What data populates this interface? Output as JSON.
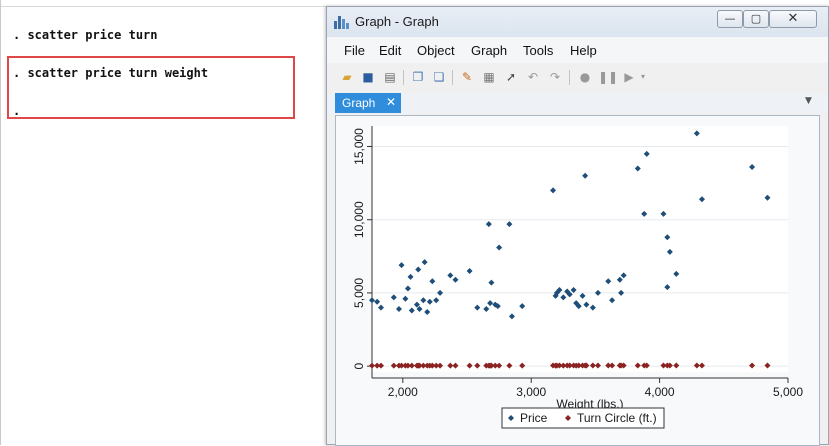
{
  "results": {
    "commands": [
      ". scatter price turn",
      ". scatter price turn weight",
      "."
    ]
  },
  "window": {
    "title": "Graph - Graph",
    "buttons": {
      "minimize": "—",
      "maximize": "▢",
      "close": "✕"
    }
  },
  "menu": [
    "File",
    "Edit",
    "Object",
    "Graph",
    "Tools",
    "Help"
  ],
  "toolbar": {
    "icons": [
      "open-icon",
      "save-icon",
      "print-icon",
      "copy-icon",
      "copy-graph-icon",
      "graph-editor-icon",
      "object-browser-icon",
      "pointer-icon",
      "undo-icon",
      "redo-icon",
      "record-icon",
      "pause-icon",
      "play-icon"
    ]
  },
  "tab": {
    "label": "Graph",
    "close": "✕"
  },
  "colors": {
    "price": "#1f4e79",
    "turn": "#8b2323",
    "tab": "#2f8ddb",
    "highlight": "#e04848"
  },
  "chart_data": {
    "type": "scatter",
    "xlabel": "Weight (lbs.)",
    "ylabel": "",
    "xlim": [
      1760,
      5000
    ],
    "ylim": [
      -400,
      16400
    ],
    "x_ticks": [
      2000,
      3000,
      4000,
      5000
    ],
    "x_tick_labels": [
      "2,000",
      "3,000",
      "4,000",
      "5,000"
    ],
    "y_ticks": [
      0,
      5000,
      10000,
      15000
    ],
    "y_tick_labels": [
      "0",
      "5,000",
      "10,000",
      "15,000"
    ],
    "grid": true,
    "legend": {
      "position": "bottom",
      "entries": [
        "Price",
        "Turn Circle (ft.)"
      ]
    },
    "series": [
      {
        "name": "Price",
        "marker": "diamond",
        "points": [
          [
            1760,
            4500
          ],
          [
            1800,
            4400
          ],
          [
            1830,
            4000
          ],
          [
            1930,
            4700
          ],
          [
            1970,
            3900
          ],
          [
            1990,
            6900
          ],
          [
            2020,
            4600
          ],
          [
            2040,
            5300
          ],
          [
            2060,
            6100
          ],
          [
            2070,
            3800
          ],
          [
            2110,
            4200
          ],
          [
            2120,
            6600
          ],
          [
            2130,
            3900
          ],
          [
            2160,
            4500
          ],
          [
            2170,
            7100
          ],
          [
            2190,
            3700
          ],
          [
            2210,
            4400
          ],
          [
            2230,
            5800
          ],
          [
            2260,
            4500
          ],
          [
            2290,
            5000
          ],
          [
            2370,
            6200
          ],
          [
            2410,
            5900
          ],
          [
            2520,
            6500
          ],
          [
            2580,
            4000
          ],
          [
            2650,
            3900
          ],
          [
            2670,
            9700
          ],
          [
            2680,
            4300
          ],
          [
            2690,
            5700
          ],
          [
            2720,
            4200
          ],
          [
            2740,
            4100
          ],
          [
            2750,
            8100
          ],
          [
            2830,
            9700
          ],
          [
            2850,
            3400
          ],
          [
            2930,
            4100
          ],
          [
            3170,
            12000
          ],
          [
            3190,
            4800
          ],
          [
            3200,
            5000
          ],
          [
            3220,
            5200
          ],
          [
            3250,
            4700
          ],
          [
            3280,
            5100
          ],
          [
            3300,
            4900
          ],
          [
            3330,
            5200
          ],
          [
            3350,
            4300
          ],
          [
            3370,
            4100
          ],
          [
            3400,
            4800
          ],
          [
            3420,
            13000
          ],
          [
            3430,
            4200
          ],
          [
            3480,
            4000
          ],
          [
            3520,
            5000
          ],
          [
            3600,
            5800
          ],
          [
            3630,
            4500
          ],
          [
            3690,
            5900
          ],
          [
            3700,
            5000
          ],
          [
            3720,
            6200
          ],
          [
            3830,
            13500
          ],
          [
            3880,
            10400
          ],
          [
            3900,
            14500
          ],
          [
            4030,
            10400
          ],
          [
            4060,
            8800
          ],
          [
            4080,
            7800
          ],
          [
            4060,
            5400
          ],
          [
            4130,
            6300
          ],
          [
            4290,
            15900
          ],
          [
            4330,
            11400
          ],
          [
            4720,
            13600
          ],
          [
            4840,
            11500
          ]
        ]
      },
      {
        "name": "Turn Circle (ft.)",
        "marker": "diamond",
        "points": [
          [
            1760,
            36
          ],
          [
            1800,
            35
          ],
          [
            1830,
            34
          ],
          [
            1930,
            35
          ],
          [
            1970,
            36
          ],
          [
            1990,
            35
          ],
          [
            2020,
            37
          ],
          [
            2040,
            35
          ],
          [
            2070,
            36
          ],
          [
            2110,
            34
          ],
          [
            2120,
            35
          ],
          [
            2130,
            36
          ],
          [
            2160,
            34
          ],
          [
            2190,
            35
          ],
          [
            2210,
            36
          ],
          [
            2230,
            35
          ],
          [
            2260,
            37
          ],
          [
            2290,
            36
          ],
          [
            2370,
            35
          ],
          [
            2410,
            36
          ],
          [
            2520,
            37
          ],
          [
            2580,
            36
          ],
          [
            2650,
            35
          ],
          [
            2670,
            38
          ],
          [
            2680,
            36
          ],
          [
            2690,
            37
          ],
          [
            2720,
            36
          ],
          [
            2750,
            38
          ],
          [
            2830,
            35
          ],
          [
            2930,
            37
          ],
          [
            3170,
            40
          ],
          [
            3190,
            38
          ],
          [
            3200,
            39
          ],
          [
            3220,
            40
          ],
          [
            3250,
            38
          ],
          [
            3280,
            41
          ],
          [
            3300,
            40
          ],
          [
            3330,
            42
          ],
          [
            3350,
            39
          ],
          [
            3370,
            40
          ],
          [
            3400,
            41
          ],
          [
            3420,
            42
          ],
          [
            3430,
            40
          ],
          [
            3480,
            41
          ],
          [
            3520,
            42
          ],
          [
            3600,
            43
          ],
          [
            3630,
            42
          ],
          [
            3690,
            43
          ],
          [
            3700,
            44
          ],
          [
            3720,
            42
          ],
          [
            3830,
            44
          ],
          [
            3880,
            45
          ],
          [
            3900,
            43
          ],
          [
            4030,
            44
          ],
          [
            4060,
            45
          ],
          [
            4080,
            43
          ],
          [
            4130,
            46
          ],
          [
            4290,
            45
          ],
          [
            4330,
            48
          ],
          [
            4720,
            45
          ],
          [
            4840,
            48
          ]
        ]
      }
    ]
  }
}
